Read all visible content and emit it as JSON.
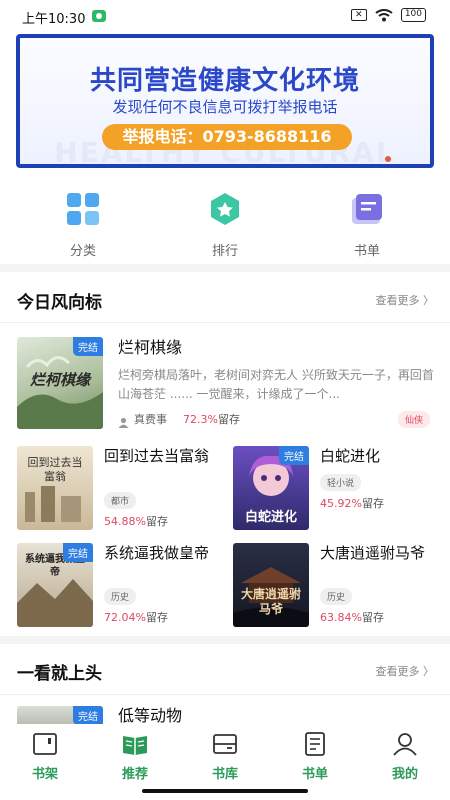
{
  "status": {
    "time": "上午10:30",
    "battery": "100"
  },
  "banner": {
    "title": "共同营造健康文化环境",
    "subtitle": "发现任何不良信息可拨打举报电话",
    "hotline": "举报电话：0793-8688116",
    "watermark": "HEALTHY CULTURAL"
  },
  "categories": [
    {
      "label": "分类",
      "icon": "grid-icon"
    },
    {
      "label": "排行",
      "icon": "ranking-badge-icon"
    },
    {
      "label": "书单",
      "icon": "booklist-icon"
    }
  ],
  "section1": {
    "title": "今日风向标",
    "more": "查看更多",
    "featured": {
      "title": "烂柯棋缘",
      "cover_text": "烂柯棋缘",
      "badge": "完结",
      "desc": "烂柯旁棋局落叶，老树间对弈无人 兴所致天元一子，再回首山海苍茫 ...... 一觉醒来，计缘成了一个...",
      "author": "真费事",
      "retention": "72.3%",
      "retention_suffix": "留存",
      "genre": "仙侠"
    },
    "grid": [
      {
        "title": "回到过去当富翁",
        "cover_text": "回到过去当富翁",
        "genre": "都市",
        "retention": "54.88%",
        "suffix": "留存",
        "badge": ""
      },
      {
        "title": "白蛇进化",
        "cover_text": "白蛇进化",
        "genre": "轻小说",
        "retention": "45.92%",
        "suffix": "留存",
        "badge": "完结"
      },
      {
        "title": "系统逼我做皇帝",
        "cover_text": "系统逼我做皇帝",
        "genre": "历史",
        "retention": "72.04%",
        "suffix": "留存",
        "badge": "完结"
      },
      {
        "title": "大唐逍遥驸马爷",
        "cover_text": "大唐逍遥驸马爷",
        "genre": "历史",
        "retention": "63.84%",
        "suffix": "留存",
        "badge": ""
      }
    ]
  },
  "section2": {
    "title": "一看就上头",
    "more": "查看更多",
    "first": {
      "title": "低等动物",
      "badge": "完结"
    }
  },
  "tabbar": [
    {
      "label": "书架",
      "icon": "bookshelf-icon"
    },
    {
      "label": "推荐",
      "icon": "open-book-icon"
    },
    {
      "label": "书库",
      "icon": "library-icon"
    },
    {
      "label": "书单",
      "icon": "list-icon"
    },
    {
      "label": "我的",
      "icon": "profile-icon"
    }
  ]
}
